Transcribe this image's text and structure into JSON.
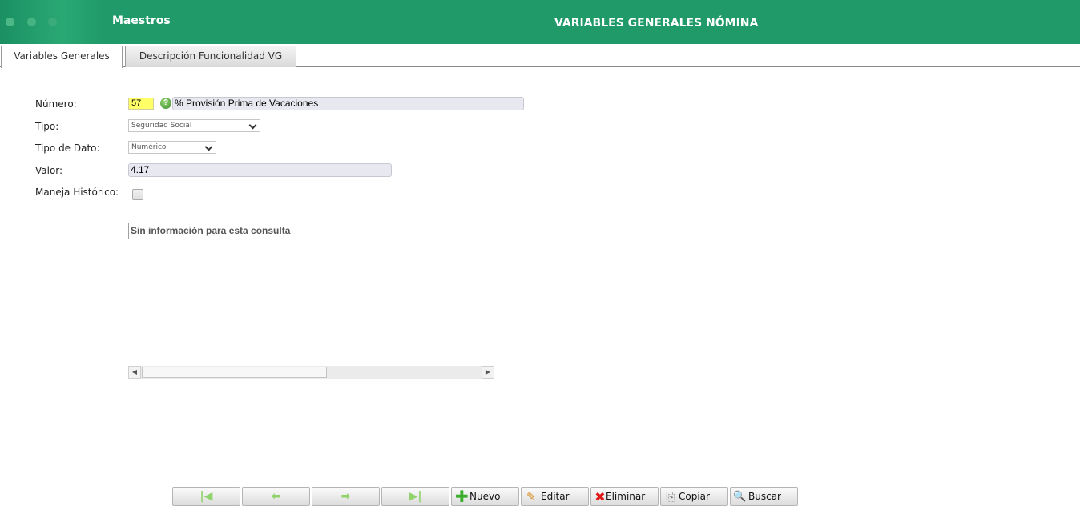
{
  "header": {
    "module": "Maestros",
    "title": "VARIABLES GENERALES NÓMINA"
  },
  "tabs": [
    {
      "label": "Variables Generales",
      "active": true
    },
    {
      "label": "Descripción Funcionalidad VG",
      "active": false
    }
  ],
  "form": {
    "numero_label": "Número:",
    "numero_value": "57",
    "descripcion_value": "% Provisión Prima de Vacaciones",
    "tipo_label": "Tipo:",
    "tipo_value": "Seguridad Social",
    "tipo_dato_label": "Tipo de Dato:",
    "tipo_dato_value": "Numérico",
    "valor_label": "Valor:",
    "valor_value": "4.17",
    "historico_label": "Maneja Histórico:",
    "historico_checked": false
  },
  "grid": {
    "empty_message": "Sin información para esta consulta"
  },
  "toolbar": {
    "first_icon": "first-record-icon",
    "prev_icon": "previous-arrow-icon",
    "next_icon": "next-arrow-icon",
    "last_icon": "last-record-icon",
    "nuevo": "Nuevo",
    "editar": "Editar",
    "eliminar": "Eliminar",
    "copiar": "Copiar",
    "buscar": "Buscar"
  },
  "colors": {
    "header_bg": "#1f9a68",
    "numero_highlight": "#ffff66",
    "nav_arrow": "#8fd36a"
  }
}
